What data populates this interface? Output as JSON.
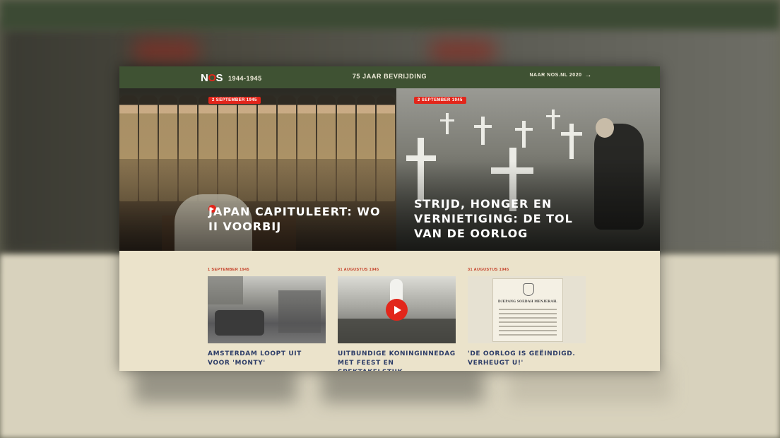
{
  "header": {
    "logo_text": "NOS",
    "years": "1944-1945",
    "title": "75 JAAR BEVRIJDING",
    "nav_link": "NAAR NOS.NL 2020",
    "nav_arrow_icon": "arrow-right-icon"
  },
  "heroes": [
    {
      "date": "2 SEPTEMBER 1945",
      "title": "JAPAN CAPITULEERT: WO II VOORBIJ",
      "has_video": true
    },
    {
      "date": "2 SEPTEMBER 1945",
      "title": "STRIJD, HONGER EN VERNIETIGING: DE TOL VAN DE OORLOG",
      "has_video": false
    }
  ],
  "cards": [
    {
      "date": "1 SEPTEMBER 1945",
      "title": "AMSTERDAM LOOPT UIT VOOR 'MONTY'",
      "has_video": false
    },
    {
      "date": "31 AUGUSTUS 1945",
      "title": "UITBUNDIGE KONINGINNEDAG MET FEEST EN SPEKTAKELSTUK",
      "has_video": true
    },
    {
      "date": "31 AUGUSTUS 1945",
      "title": "'DE OORLOG IS GEËINDIGD. VERHEUGT U!'",
      "has_video": false,
      "doc_heading": "DJEPANG SOEDAH MENJERAH."
    }
  ],
  "colors": {
    "header_green": "#3f5233",
    "accent_red": "#e2261b",
    "card_title_blue": "#2c3c67",
    "background_cream": "#ebe3cb"
  }
}
